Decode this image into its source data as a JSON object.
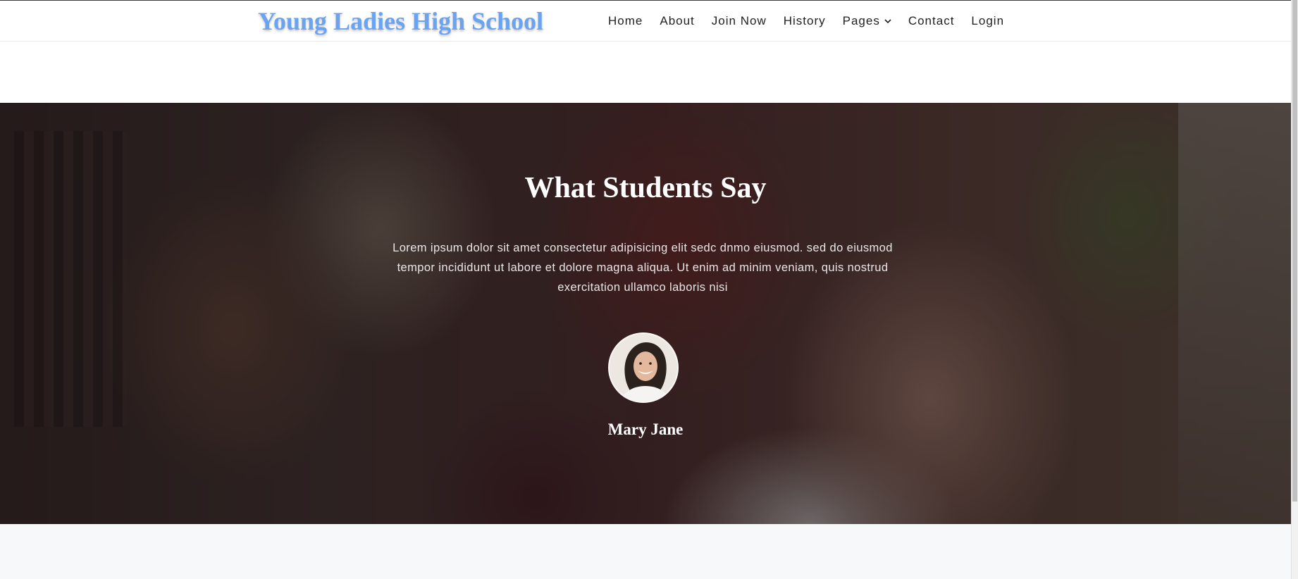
{
  "brand": {
    "name": "Young Ladies High School",
    "color": "#6aa3f0"
  },
  "nav": {
    "items": [
      {
        "label": "Home"
      },
      {
        "label": "About"
      },
      {
        "label": "Join Now"
      },
      {
        "label": "History"
      },
      {
        "label": "Pages",
        "icon": "chevron-down-icon"
      },
      {
        "label": "Contact"
      },
      {
        "label": "Login"
      }
    ]
  },
  "testimonial": {
    "title": "What Students Say",
    "quote": "Lorem ipsum dolor sit amet consectetur adipisicing elit sedc dnmo eiusmod. sed do eiusmod tempor incididunt ut labore et dolore magna aliqua. Ut enim ad minim veniam, quis nostrud exercitation ullamco laboris nisi",
    "student_name": "Mary Jane"
  }
}
